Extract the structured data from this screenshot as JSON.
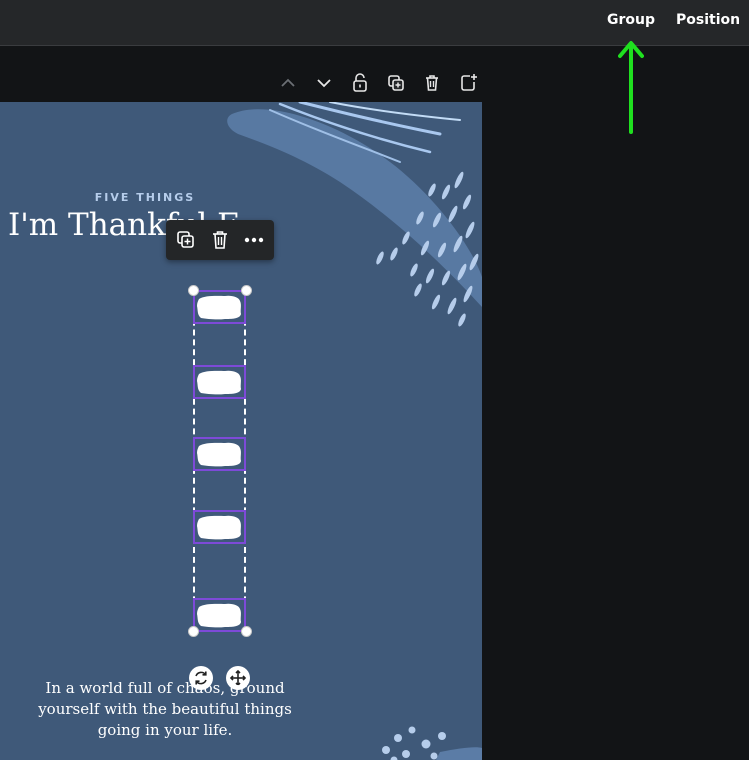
{
  "topbar": {
    "group_label": "Group",
    "position_label": "Position"
  },
  "annotation": {
    "arrow_color": "#1fe01f"
  },
  "canvas_toolbar": {
    "icons": [
      "chevron-up-icon",
      "chevron-down-icon",
      "lock-icon",
      "duplicate-icon",
      "trash-icon",
      "add-page-icon"
    ]
  },
  "design": {
    "subtitle": "FIVE THINGS",
    "title": "I'm Thankful F",
    "body": "In a world full of chaos, ground yourself with the beautiful things going in your life.",
    "background": "#3f5979",
    "accent": "#b6cdeb"
  },
  "floating_toolbar": {
    "icons": [
      "duplicate-icon",
      "trash-icon",
      "more-icon"
    ]
  },
  "selection": {
    "color": "#7d4ad8",
    "item_count": 5
  },
  "element_controls": {
    "icons": [
      "rotate-icon",
      "move-icon"
    ]
  }
}
